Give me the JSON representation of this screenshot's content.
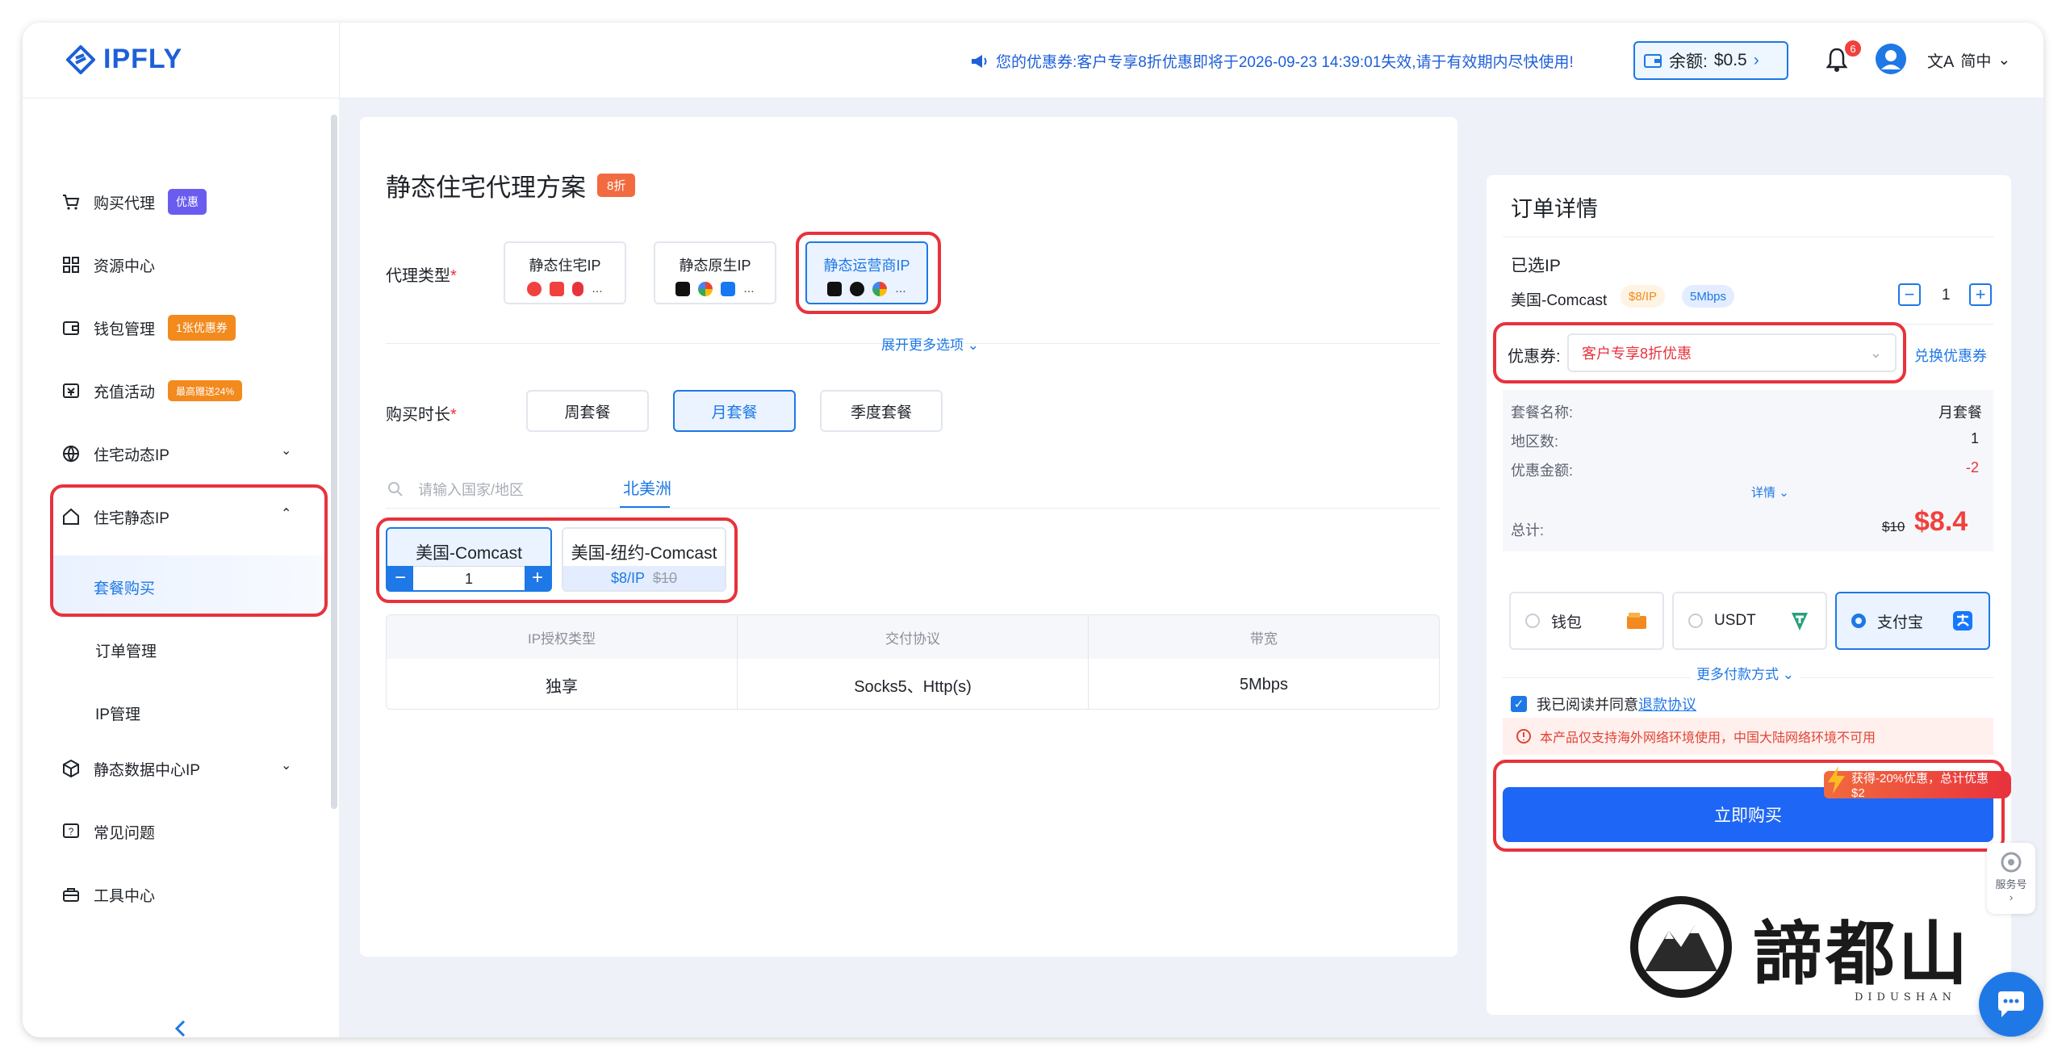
{
  "header": {
    "logo": "IPFLY",
    "notice": "您的优惠券:客户专享8折优惠即将于2026-09-23 14:39:01失效,请于有效期内尽快使用!",
    "balance_label": "余额:",
    "balance_value": "$0.5",
    "notification_count": "6",
    "language": "简中"
  },
  "sidebar": {
    "items": [
      {
        "label": "购买代理",
        "tag": "优惠"
      },
      {
        "label": "资源中心"
      },
      {
        "label": "钱包管理",
        "tag": "1张优惠券"
      },
      {
        "label": "充值活动",
        "tag": "最高赠送24%"
      },
      {
        "label": "住宅动态IP"
      },
      {
        "label": "住宅静态IP"
      },
      {
        "label": "套餐购买"
      },
      {
        "label": "订单管理"
      },
      {
        "label": "IP管理"
      },
      {
        "label": "静态数据中心IP"
      },
      {
        "label": "常见问题"
      },
      {
        "label": "工具中心"
      }
    ]
  },
  "main": {
    "title": "静态住宅代理方案",
    "title_badge": "8折",
    "proxy_type_label": "代理类型",
    "proxy_types": [
      {
        "label": "静态住宅IP"
      },
      {
        "label": "静态原生IP"
      },
      {
        "label": "静态运营商IP"
      }
    ],
    "more_icon_text": "...",
    "expand_more": "展开更多选项",
    "duration_label": "购买时长",
    "durations": [
      "周套餐",
      "月套餐",
      "季度套餐"
    ],
    "search_placeholder": "请输入国家/地区",
    "region_tab": "北美洲",
    "isps": [
      {
        "name": "美国-Comcast",
        "qty": "1"
      },
      {
        "name": "美国-纽约-Comcast",
        "price": "$8/IP",
        "old_price": "$10"
      }
    ],
    "spec_headers": [
      "IP授权类型",
      "交付协议",
      "带宽"
    ],
    "spec_values": [
      "独享",
      "Socks5、Http(s)",
      "5Mbps"
    ]
  },
  "order": {
    "title": "订单详情",
    "selected_label": "已选IP",
    "selected_item": "美国-Comcast",
    "item_price_tag": "$8/IP",
    "item_speed_tag": "5Mbps",
    "qty": "1",
    "coupon_label": "优惠券:",
    "coupon_value": "客户专享8折优惠",
    "redeem_link": "兑换优惠券",
    "rows": [
      {
        "label": "套餐名称:",
        "value": "月套餐"
      },
      {
        "label": "地区数:",
        "value": "1"
      },
      {
        "label": "优惠金额:",
        "value": "-2"
      }
    ],
    "detail_toggle": "详情",
    "total_label": "总计:",
    "total_old": "$10",
    "total_value": "$8.4",
    "payments": [
      "钱包",
      "USDT",
      "支付宝"
    ],
    "more_payments": "更多付款方式",
    "agree_text": "我已阅读并同意",
    "agree_link": "退款协议",
    "warning": "本产品仅支持海外网络环境使用，中国大陆网络环境不可用",
    "promo_banner": "获得-20%优惠，总计优惠$2",
    "buy_button": "立即购买"
  },
  "floating": {
    "service_label": "服务号",
    "watermark": "諦都山",
    "watermark_sub": "DIDUSHAN"
  },
  "colors": {
    "brand": "#1e78e6",
    "danger": "#e8323c",
    "accent_orange": "#f26a3f"
  }
}
